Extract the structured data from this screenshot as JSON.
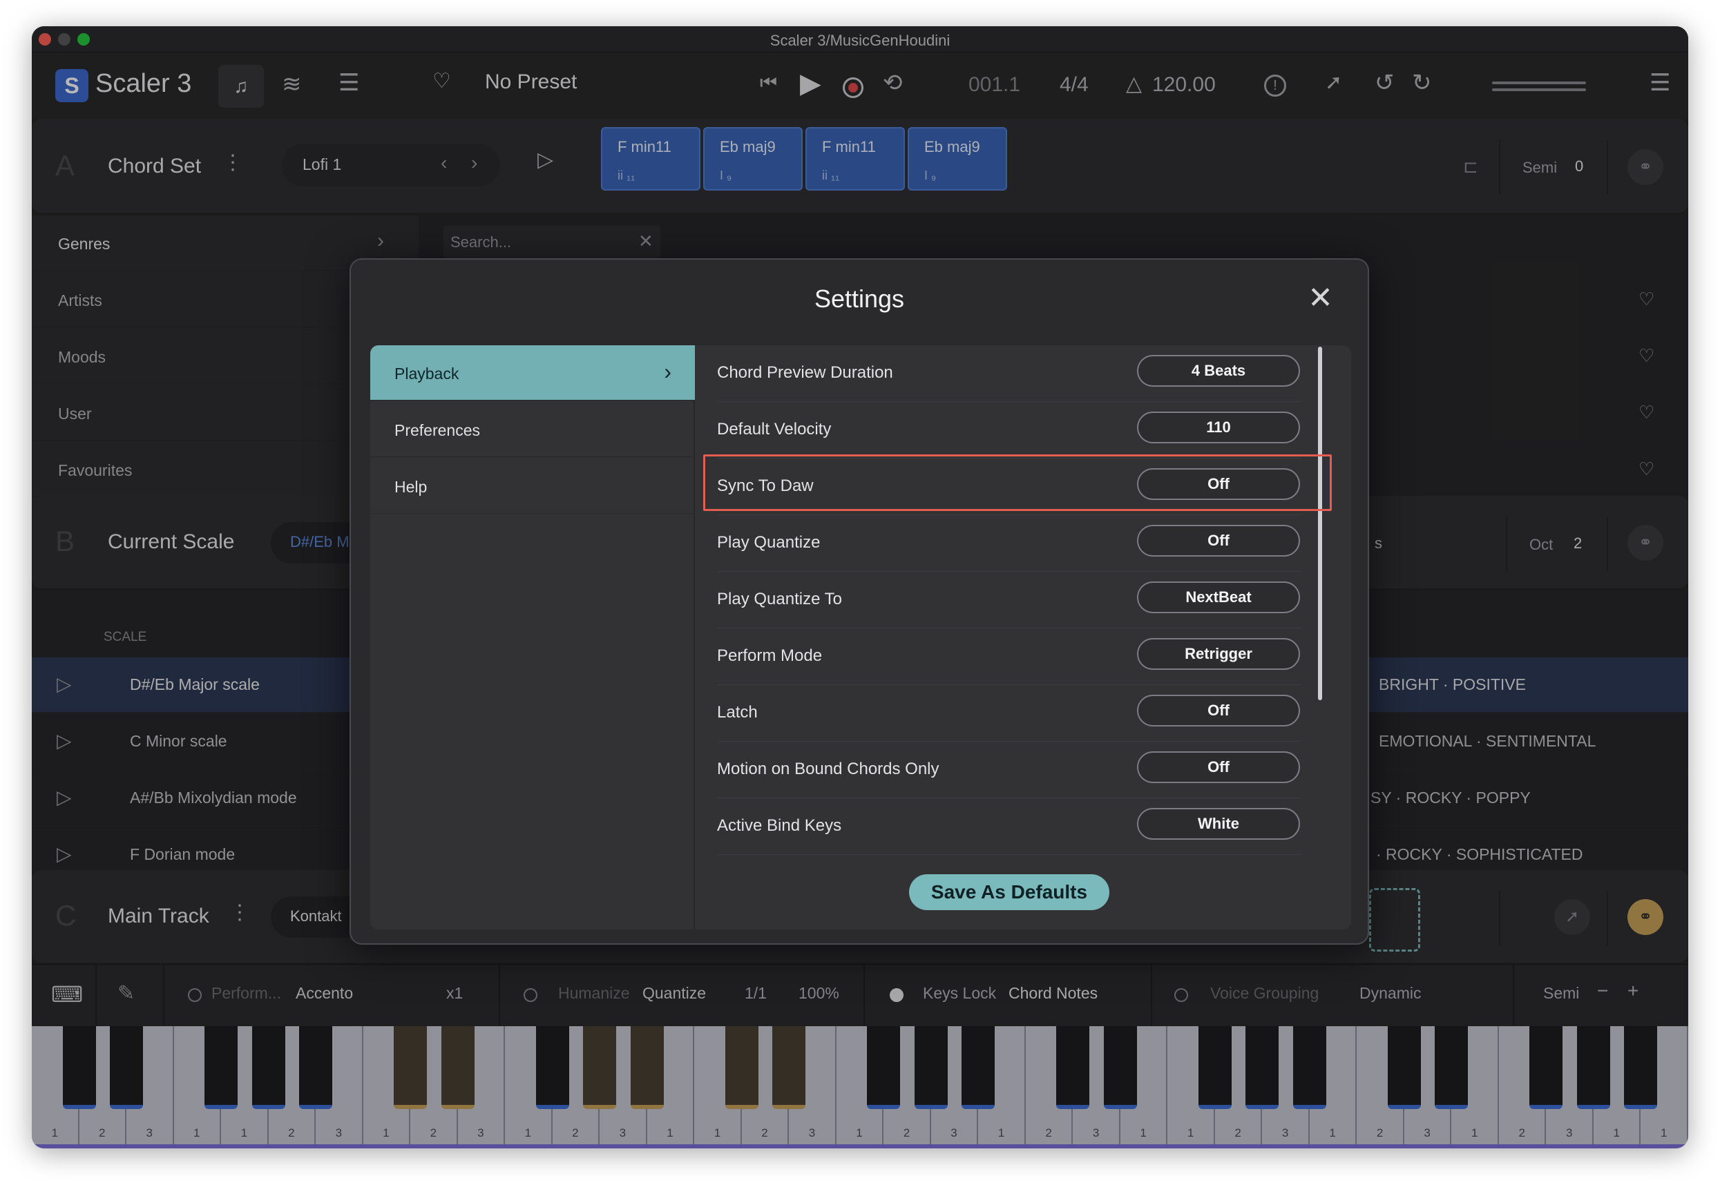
{
  "window": {
    "title": "Scaler 3/MusicGenHoudini",
    "traffic_colors": [
      "#ff5f57",
      "#febc2e",
      "#28c840"
    ]
  },
  "header": {
    "logo_letter": "S",
    "app_name": "Scaler 3",
    "preset": "No Preset",
    "position": "001.1",
    "time_signature": "4/4",
    "tempo": "120.00"
  },
  "chord_set": {
    "letter": "A",
    "title": "Chord Set",
    "preset": "Lofi 1",
    "chords": [
      {
        "name": "F min11",
        "roman": "ii ₁₁"
      },
      {
        "name": "Eb maj9",
        "roman": "I ₉"
      },
      {
        "name": "F min11",
        "roman": "ii ₁₁"
      },
      {
        "name": "Eb maj9",
        "roman": "I ₉"
      }
    ],
    "semi_label": "Semi",
    "semi_value": "0"
  },
  "browser": {
    "categories": [
      "Genres",
      "Artists",
      "Moods",
      "User",
      "Favourites"
    ],
    "search_placeholder": "Search..."
  },
  "current_scale": {
    "letter": "B",
    "title": "Current Scale",
    "scale_chip": "D#/Eb M",
    "partial": "s",
    "oct_label": "Oct",
    "oct_value": "2",
    "column_header": "SCALE",
    "rows": [
      {
        "name": "D#/Eb Major scale",
        "tags": "BRIGHT · POSITIVE"
      },
      {
        "name": "C Minor scale",
        "tags": "EMOTIONAL · SENTIMENTAL"
      },
      {
        "name": "A#/Bb Mixolydian mode",
        "tags": "SY · ROCKY · POPPY"
      },
      {
        "name": "F Dorian mode",
        "tags": "· ROCKY · SOPHISTICATED"
      }
    ]
  },
  "main_track": {
    "letter": "C",
    "title": "Main Track",
    "instrument": "Kontakt"
  },
  "toolbar": {
    "perform_label": "Perform...",
    "perform_value": "Accento",
    "multiplier": "x1",
    "humanize": "Humanize",
    "quantize": "Quantize",
    "q_value": "1/1",
    "q_percent": "100%",
    "keys_lock": "Keys Lock",
    "keys_lock_value": "Chord Notes",
    "voice_grouping": "Voice Grouping",
    "voice_value": "Dynamic",
    "semi_label": "Semi"
  },
  "keyboard": {
    "numbers": [
      "1",
      "2",
      "3",
      "1",
      "1",
      "2",
      "3",
      "1",
      "2",
      "3",
      "1",
      "2",
      "3",
      "1",
      "1",
      "2",
      "3",
      "1",
      "2",
      "3",
      "1",
      "2",
      "3",
      "1",
      "1",
      "2",
      "3",
      "1",
      "2",
      "3",
      "1",
      "2",
      "3",
      "1",
      "1"
    ]
  },
  "settings": {
    "title": "Settings",
    "nav": [
      {
        "label": "Playback"
      },
      {
        "label": "Preferences"
      },
      {
        "label": "Help"
      }
    ],
    "rows": [
      {
        "label": "Chord Preview Duration",
        "value": "4 Beats"
      },
      {
        "label": "Default Velocity",
        "value": "110"
      },
      {
        "label": "Sync To Daw",
        "value": "Off"
      },
      {
        "label": "Play Quantize",
        "value": "Off"
      },
      {
        "label": "Play Quantize To",
        "value": "NextBeat"
      },
      {
        "label": "Perform Mode",
        "value": "Retrigger"
      },
      {
        "label": "Latch",
        "value": "Off"
      },
      {
        "label": "Motion on Bound Chords Only",
        "value": "Off"
      },
      {
        "label": "Active Bind Keys",
        "value": "White"
      }
    ],
    "save_label": "Save As Defaults"
  },
  "colors": {
    "accent_teal": "#73b0b4",
    "chord_blue": "#3b66b8",
    "highlight": "#e35d50",
    "gold": "#c8a25a"
  }
}
